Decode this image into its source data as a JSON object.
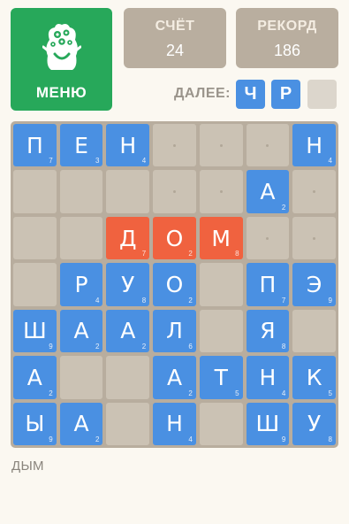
{
  "menu": {
    "label": "МЕНЮ",
    "icon": "monster-icon"
  },
  "score": {
    "label": "СЧЁТ",
    "value": "24"
  },
  "record": {
    "label": "РЕКОРД",
    "value": "186"
  },
  "next": {
    "label": "ДАЛЕЕ:",
    "tiles": [
      "Ч",
      "Р",
      ""
    ]
  },
  "board": {
    "rows": [
      [
        {
          "l": "П",
          "p": "7",
          "c": "blue"
        },
        {
          "l": "Е",
          "p": "3",
          "c": "blue"
        },
        {
          "l": "Н",
          "p": "4",
          "c": "blue"
        },
        {
          "l": "",
          "p": "",
          "c": "empty"
        },
        {
          "l": "",
          "p": "",
          "c": "empty"
        },
        {
          "l": "",
          "p": "",
          "c": "empty"
        },
        {
          "l": "Н",
          "p": "4",
          "c": "blue"
        }
      ],
      [
        {
          "l": "",
          "p": "",
          "c": "plain"
        },
        {
          "l": "",
          "p": "",
          "c": "plain"
        },
        {
          "l": "",
          "p": "",
          "c": "plain"
        },
        {
          "l": "",
          "p": "",
          "c": "empty"
        },
        {
          "l": "",
          "p": "",
          "c": "empty"
        },
        {
          "l": "А",
          "p": "2",
          "c": "blue"
        },
        {
          "l": "",
          "p": "",
          "c": "empty"
        }
      ],
      [
        {
          "l": "",
          "p": "",
          "c": "plain"
        },
        {
          "l": "",
          "p": "",
          "c": "plain"
        },
        {
          "l": "Д",
          "p": "7",
          "c": "red"
        },
        {
          "l": "О",
          "p": "2",
          "c": "red"
        },
        {
          "l": "М",
          "p": "8",
          "c": "red"
        },
        {
          "l": "",
          "p": "",
          "c": "empty"
        },
        {
          "l": "",
          "p": "",
          "c": "empty"
        }
      ],
      [
        {
          "l": "",
          "p": "",
          "c": "plain"
        },
        {
          "l": "Р",
          "p": "4",
          "c": "blue"
        },
        {
          "l": "У",
          "p": "8",
          "c": "blue"
        },
        {
          "l": "О",
          "p": "2",
          "c": "blue"
        },
        {
          "l": "",
          "p": "",
          "c": "plain"
        },
        {
          "l": "П",
          "p": "7",
          "c": "blue"
        },
        {
          "l": "Э",
          "p": "9",
          "c": "blue"
        }
      ],
      [
        {
          "l": "Ш",
          "p": "9",
          "c": "blue"
        },
        {
          "l": "А",
          "p": "2",
          "c": "blue"
        },
        {
          "l": "А",
          "p": "2",
          "c": "blue"
        },
        {
          "l": "Л",
          "p": "6",
          "c": "blue"
        },
        {
          "l": "",
          "p": "",
          "c": "plain"
        },
        {
          "l": "Я",
          "p": "8",
          "c": "blue"
        },
        {
          "l": "",
          "p": "",
          "c": "plain"
        }
      ],
      [
        {
          "l": "А",
          "p": "2",
          "c": "blue"
        },
        {
          "l": "",
          "p": "",
          "c": "plain"
        },
        {
          "l": "",
          "p": "",
          "c": "plain"
        },
        {
          "l": "А",
          "p": "2",
          "c": "blue"
        },
        {
          "l": "Т",
          "p": "5",
          "c": "blue"
        },
        {
          "l": "Н",
          "p": "4",
          "c": "blue"
        },
        {
          "l": "К",
          "p": "5",
          "c": "blue"
        }
      ],
      [
        {
          "l": "Ы",
          "p": "9",
          "c": "blue"
        },
        {
          "l": "А",
          "p": "2",
          "c": "blue"
        },
        {
          "l": "",
          "p": "",
          "c": "plain"
        },
        {
          "l": "Н",
          "p": "4",
          "c": "blue"
        },
        {
          "l": "",
          "p": "",
          "c": "plain"
        },
        {
          "l": "Ш",
          "p": "9",
          "c": "blue"
        },
        {
          "l": "У",
          "p": "8",
          "c": "blue"
        }
      ]
    ]
  },
  "current_word": "ДЫМ",
  "colors": {
    "menu": "#27a85a",
    "score_box": "#b9ae9f",
    "tile_blue": "#4a90e2",
    "tile_red": "#f0623f",
    "board": "#b8ad9e",
    "cell": "#cbc2b4"
  }
}
